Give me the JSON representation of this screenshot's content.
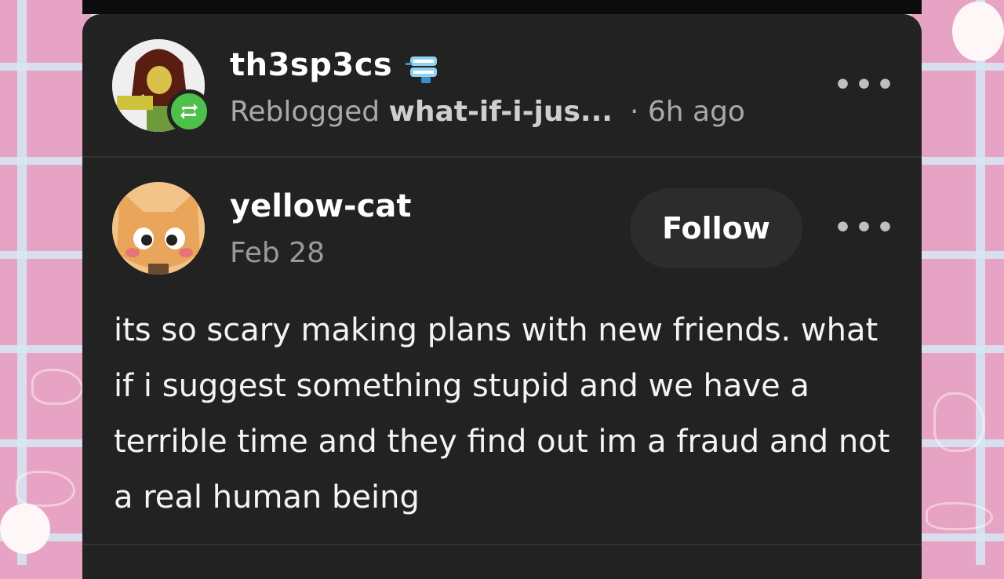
{
  "reblog": {
    "username": "th3sp3cs",
    "reblogged_label": "Reblogged",
    "reblogged_from": "what-if-i-jus...",
    "time": "· 6h ago",
    "more": "•••"
  },
  "post": {
    "username": "yellow-cat",
    "date": "Feb 28",
    "follow_label": "Follow",
    "more": "•••",
    "body": "its so scary making plans with new friends. what if i suggest something stupid and we have a terrible time and they find out im a fraud and not a real human being"
  },
  "colors": {
    "card": "#222222",
    "reblog_badge": "#4fc14a",
    "background": "#e7a3c3"
  },
  "icons": {
    "reblog_badge": "reblog-arrows-icon",
    "name_badge": "chattering-teeth-icon",
    "more": "more-dots-icon"
  }
}
